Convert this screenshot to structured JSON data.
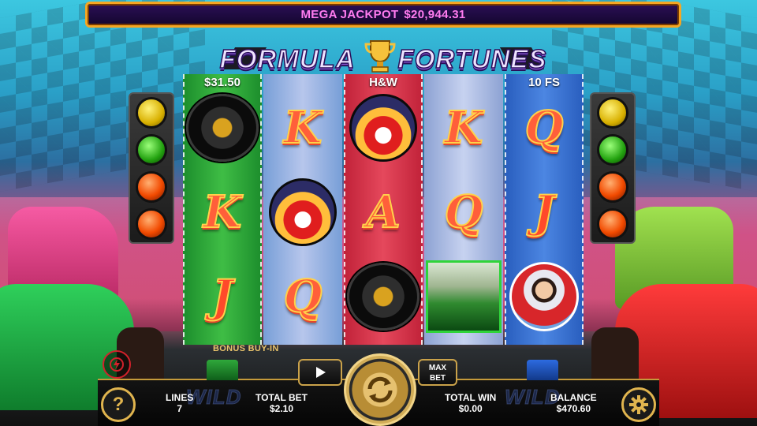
{
  "jackpot": {
    "label": "MEGA JACKPOT",
    "value": "$20,944.31"
  },
  "logo": {
    "word1": "FORMULA",
    "word2": "FORTUNES"
  },
  "reel_headers": [
    "$31.50",
    "",
    "H&W",
    "",
    "10 FS"
  ],
  "reels": [
    [
      "tyre",
      "K",
      "J"
    ],
    [
      "K",
      "driver",
      "Q"
    ],
    [
      "driver",
      "A",
      "tyre"
    ],
    [
      "K",
      "Q",
      "race-car"
    ],
    [
      "Q",
      "J",
      "hero-driver"
    ]
  ],
  "colors": {
    "jackpot_text": "#ff7cf0",
    "gold": "#e0b44e",
    "reel_green": "#3fbd45",
    "reel_red": "#e5485c",
    "reel_blue": "#4c86e2"
  },
  "bottom": {
    "bonus_buy_label": "BONUS BUY-IN",
    "lines": {
      "label": "LINES",
      "value": "7"
    },
    "total_bet": {
      "label": "TOTAL BET",
      "value": "$2.10"
    },
    "total_win": {
      "label": "TOTAL WIN",
      "value": "$0.00"
    },
    "balance": {
      "label": "BALANCE",
      "value": "$470.60"
    },
    "max_bet_label": "MAX\nBET",
    "help_label": "?",
    "wild_left": "WILD",
    "wild_right": "WILD"
  },
  "icons": {
    "help": "question-icon",
    "speed": "turbo-icon",
    "autoplay": "play-icon",
    "spin": "spin-arrows-icon",
    "settings": "gear-icon"
  }
}
